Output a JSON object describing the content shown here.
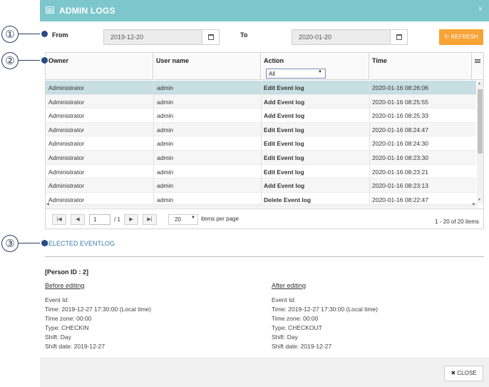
{
  "callouts": [
    "①",
    "②",
    "③"
  ],
  "modal": {
    "title": "ADMIN LOGS",
    "close_x": "×"
  },
  "filters": {
    "from_label": "From",
    "from_value": "2019-12-20",
    "to_label": "To",
    "to_value": "2020-01-20",
    "refresh_label": "↻ REFRESH"
  },
  "grid": {
    "columns": [
      "Owner",
      "User name",
      "Action",
      "Time"
    ],
    "action_filter": "All",
    "rows": [
      {
        "owner": "Administrator",
        "user": "admin",
        "action": "Edit Event log",
        "time": "2020-01-16 08:26:06"
      },
      {
        "owner": "Administrator",
        "user": "admin",
        "action": "Add Event log",
        "time": "2020-01-16 08:25:55"
      },
      {
        "owner": "Administrator",
        "user": "admin",
        "action": "Add Event log",
        "time": "2020-01-16 08:25:33"
      },
      {
        "owner": "Administrator",
        "user": "admin",
        "action": "Edit Event log",
        "time": "2020-01-16 08:24:47"
      },
      {
        "owner": "Administrator",
        "user": "admin",
        "action": "Edit Event log",
        "time": "2020-01-16 08:24:30"
      },
      {
        "owner": "Administrator",
        "user": "admin",
        "action": "Edit Event log",
        "time": "2020-01-16 08:23:30"
      },
      {
        "owner": "Administrator",
        "user": "admin",
        "action": "Edit Event log",
        "time": "2020-01-16 08:23:21"
      },
      {
        "owner": "Administrator",
        "user": "admin",
        "action": "Add Event log",
        "time": "2020-01-16 08:23:13"
      },
      {
        "owner": "Administrator",
        "user": "admin",
        "action": "Delete Event log",
        "time": "2020-01-16 08:22:47"
      }
    ],
    "pager": {
      "page": "1",
      "of_pages": "/ 1",
      "per_page": "20",
      "per_page_label": "items per page",
      "summary": "1 - 20 of 20 items"
    }
  },
  "selected": {
    "title": "SELECTED EVENTLOG",
    "person_id": "[Person ID : 2]",
    "before": {
      "title": "Before editing",
      "lines": [
        "Event Id:",
        "Time: 2019-12-27 17:30:00 (Local time)",
        "Time zone: 00:00",
        "Type: CHECKIN",
        "Shift: Day",
        "Shift date: 2019-12-27"
      ]
    },
    "after": {
      "title": "After editing",
      "lines": [
        "Event Id:",
        "Time: 2019-12-27 17:30:00 (Local time)",
        "Time zone: 00:00",
        "Type: CHECKOUT",
        "Shift: Day",
        "Shift date: 2019-12-27"
      ]
    }
  },
  "footer": {
    "close_label": "✖ CLOSE"
  }
}
